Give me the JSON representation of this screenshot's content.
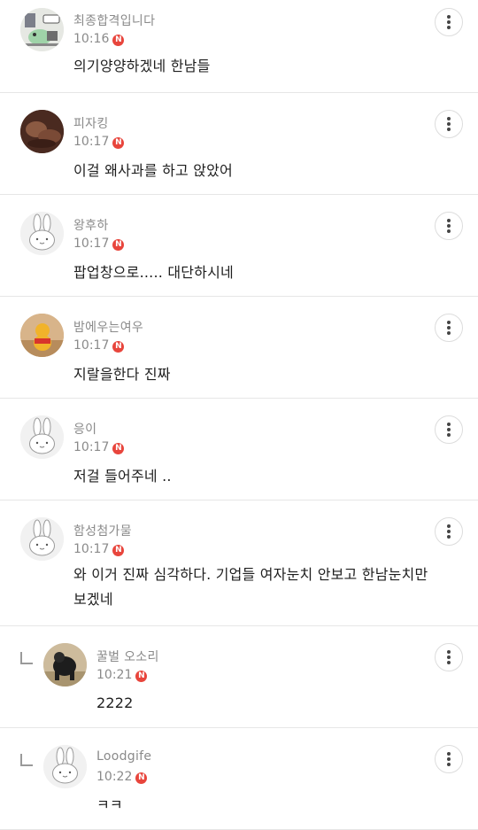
{
  "comments": [
    {
      "name": "최종합격입니다",
      "time": "10:16",
      "badge": "N",
      "text": "의기양양하겠네 한남들",
      "avatar": "cartoon-avatar",
      "reply": false
    },
    {
      "name": "피자킹",
      "time": "10:17",
      "badge": "N",
      "text": "이걸 왜사과를 하고 앉았어",
      "avatar": "photo-avatar",
      "reply": false
    },
    {
      "name": "왕후하",
      "time": "10:17",
      "badge": "N",
      "text": "팝업창으로..... 대단하시네",
      "avatar": "bunny-avatar",
      "reply": false
    },
    {
      "name": "밤에우는여우",
      "time": "10:17",
      "badge": "N",
      "text": "지랄을한다 진짜",
      "avatar": "pooh-avatar",
      "reply": false
    },
    {
      "name": "응이",
      "time": "10:17",
      "badge": "N",
      "text": "저걸 들어주네 ..",
      "avatar": "bunny-avatar",
      "reply": false
    },
    {
      "name": "함성첨가물",
      "time": "10:17",
      "badge": "N",
      "text": "와 이거 진짜 심각하다. 기업들 여자눈치 안보고 한남눈치만 보겠네",
      "avatar": "bunny-avatar",
      "reply": false
    },
    {
      "name": "꿀벌 오소리",
      "time": "10:21",
      "badge": "N",
      "text": "2222",
      "avatar": "animal-avatar",
      "reply": true
    },
    {
      "name": "Loodgife",
      "time": "10:22",
      "badge": "N",
      "text": "ㅋㅋ",
      "avatar": "bunny-avatar",
      "reply": true
    }
  ],
  "icons": {
    "more": "more-vertical-icon",
    "reply": "reply-arrow-icon"
  },
  "colors": {
    "badge": "#e8453c",
    "meta": "#8a8a8a",
    "divider": "#e6e6e6"
  }
}
